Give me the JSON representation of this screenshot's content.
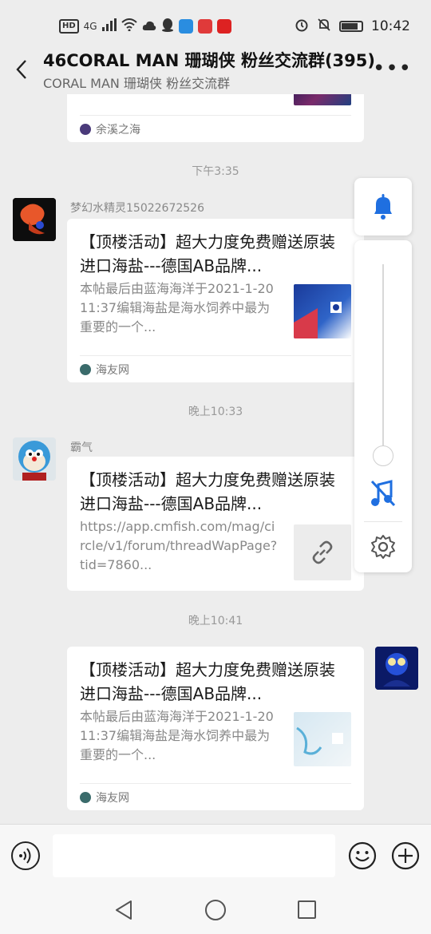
{
  "status_bar": {
    "hd": "HD",
    "network": "4G",
    "time": "10:42"
  },
  "header": {
    "title": "46CORAL MAN 珊瑚侠 粉丝交流群(395)",
    "subtitle": "CORAL MAN 珊瑚侠 粉丝交流群",
    "more_label": "•••"
  },
  "messages": [
    {
      "source": "余溪之海"
    },
    {
      "timestamp": "下午3:35",
      "sender": "梦幻水精灵15022672526",
      "title": "【顶楼活动】超大力度免费赠送原装进口海盐---德国AB品牌...",
      "desc": "本帖最后由蓝海海洋于2021-1-2011:37编辑海盐是海水饲养中最为重要的一个...",
      "source": "海友网"
    },
    {
      "timestamp": "晚上10:33",
      "sender": "霸气",
      "title": "【顶楼活动】超大力度免费赠送原装进口海盐---德国AB品牌...",
      "desc": "https://app.cmfish.com/mag/circle/v1/forum/threadWapPage?tid=7860..."
    },
    {
      "timestamp": "晚上10:41",
      "title": "【顶楼活动】超大力度免费赠送原装进口海盐---德国AB品牌...",
      "desc": "本帖最后由蓝海海洋于2021-1-2011:37编辑海盐是海水饲养中最为重要的一个...",
      "source": "海友网"
    }
  ],
  "input": {
    "placeholder": ""
  },
  "colors": {
    "accent_blue": "#1f6fe0",
    "chat_bg": "#ededed"
  },
  "icons": [
    "back-arrow-icon",
    "more-icon",
    "bell-icon",
    "music-off-icon",
    "gear-icon",
    "link-icon",
    "voice-icon",
    "emoji-icon",
    "plus-icon"
  ]
}
